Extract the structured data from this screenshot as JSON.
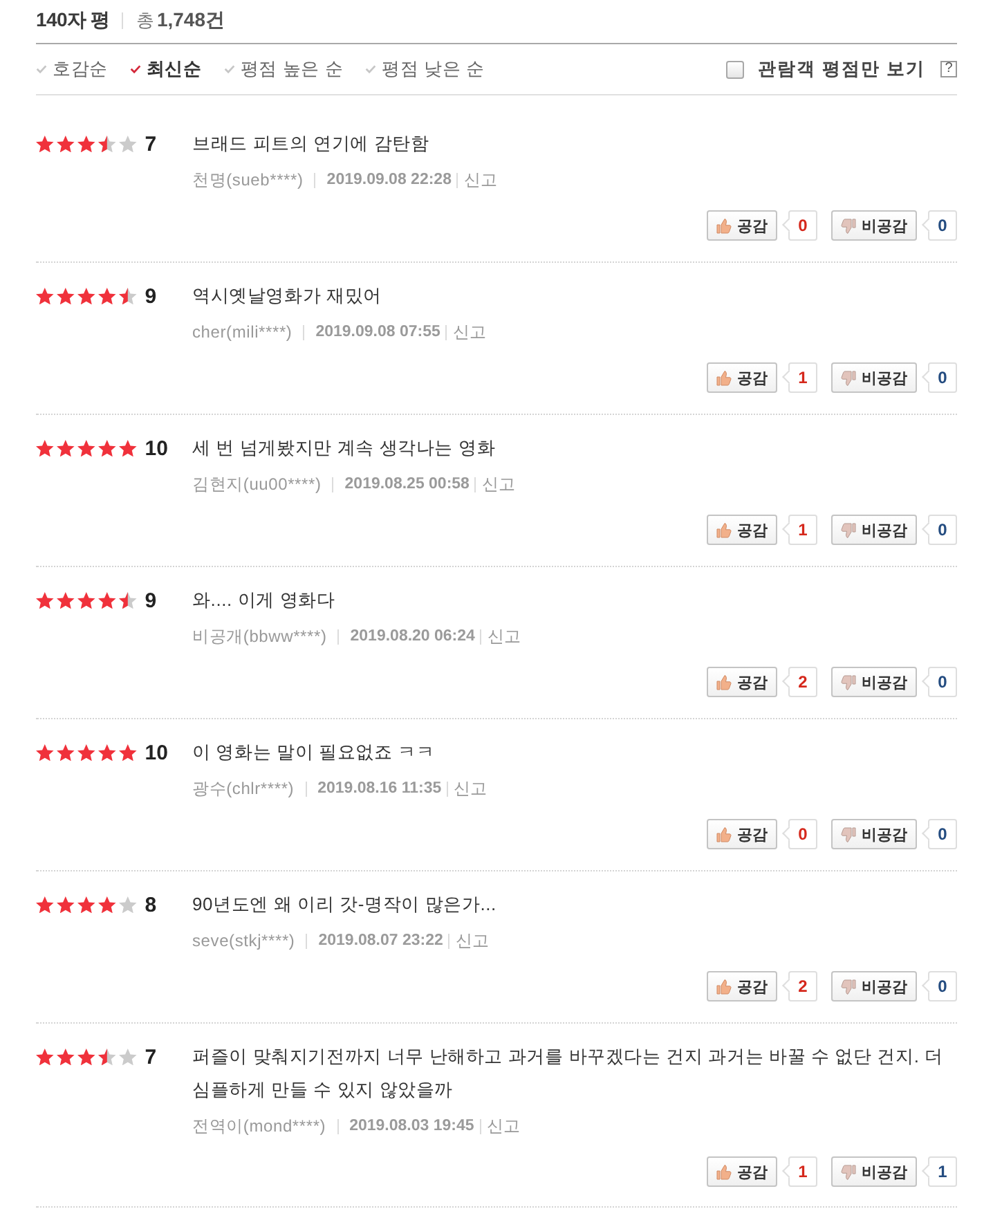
{
  "section": {
    "title": "140자 평",
    "total": "총**1,748건**"
  },
  "sort_options": [
    {
      "label": "호감순",
      "selected": false
    },
    {
      "label": "최신순",
      "selected": true
    },
    {
      "label": "평점 높은 순",
      "selected": false
    },
    {
      "label": "평점 낮은 순",
      "selected": false
    }
  ],
  "filter": {
    "label": "관람객 평점만 보기",
    "checked": false,
    "help": "?"
  },
  "reviews": [
    {
      "stars": 3.5,
      "score": "7",
      "text": "브래드 피트의 연기에 감탄함",
      "author": "천명(sueb****)",
      "date": "2019.09.08 22:28",
      "report": "신고",
      "like": {
        "label": "공감",
        "count": "0"
      },
      "dislike": {
        "label": "비공감",
        "count": "0"
      }
    },
    {
      "stars": 4.5,
      "score": "9",
      "text": "역시옛날영화가 재밌어",
      "author": "cher(mili****)",
      "date": "2019.09.08 07:55",
      "report": "신고",
      "like": {
        "label": "공감",
        "count": "1"
      },
      "dislike": {
        "label": "비공감",
        "count": "0"
      }
    },
    {
      "stars": 5,
      "score": "10",
      "text": "세 번 넘게봤지만 계속 생각나는 영화",
      "author": "김현지(uu00****)",
      "date": "2019.08.25 00:58",
      "report": "신고",
      "like": {
        "label": "공감",
        "count": "1"
      },
      "dislike": {
        "label": "비공감",
        "count": "0"
      }
    },
    {
      "stars": 4.5,
      "score": "9",
      "text": "와.... 이게 영화다",
      "author": "비공개(bbww****)",
      "date": "2019.08.20 06:24",
      "report": "신고",
      "like": {
        "label": "공감",
        "count": "2"
      },
      "dislike": {
        "label": "비공감",
        "count": "0"
      }
    },
    {
      "stars": 5,
      "score": "10",
      "text": "이 영화는 말이 필요없죠 ㅋㅋ",
      "author": "광수(chlr****)",
      "date": "2019.08.16 11:35",
      "report": "신고",
      "like": {
        "label": "공감",
        "count": "0"
      },
      "dislike": {
        "label": "비공감",
        "count": "0"
      }
    },
    {
      "stars": 4,
      "score": "8",
      "text": "90년도엔 왜 이리 갓-명작이 많은가...",
      "author": "seve(stkj****)",
      "date": "2019.08.07 23:22",
      "report": "신고",
      "like": {
        "label": "공감",
        "count": "2"
      },
      "dislike": {
        "label": "비공감",
        "count": "0"
      }
    },
    {
      "stars": 3.5,
      "score": "7",
      "text": "퍼즐이 맞춰지기전까지 너무 난해하고 과거를 바꾸겠다는 건지 과거는 바꿀 수 없단 건지. 더 심플하게 만들 수 있지 않았을까",
      "author": "전역이(mond****)",
      "date": "2019.08.03 19:45",
      "report": "신고",
      "like": {
        "label": "공감",
        "count": "1"
      },
      "dislike": {
        "label": "비공감",
        "count": "1"
      }
    }
  ]
}
